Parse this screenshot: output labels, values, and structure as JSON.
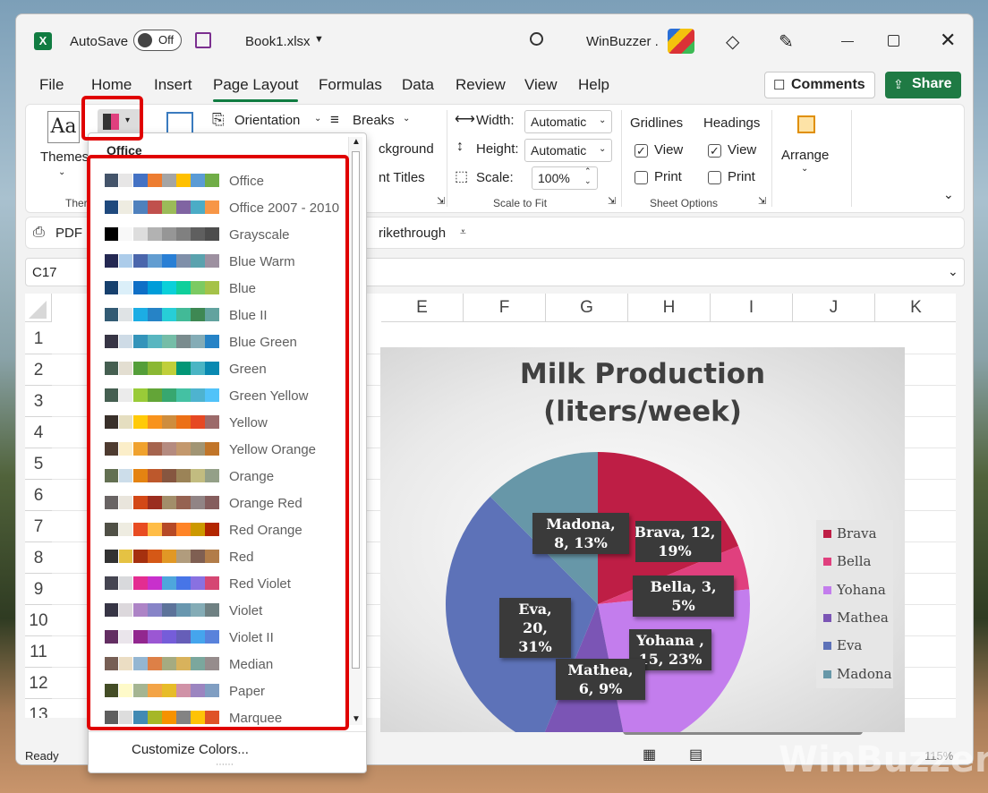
{
  "titlebar": {
    "autosave": "AutoSave",
    "toggle": "Off",
    "filename": "Book1.xlsx",
    "account": "WinBuzzer ."
  },
  "tabs": [
    "File",
    "Home",
    "Insert",
    "Page Layout",
    "Formulas",
    "Data",
    "Review",
    "View",
    "Help"
  ],
  "buttons": {
    "comments": "Comments",
    "share": "Share"
  },
  "ribbon": {
    "themes": "Themes",
    "themes_group": "Ther",
    "orientation": "Orientation",
    "breaks": "Breaks",
    "background": "ckground",
    "print_titles": "nt Titles",
    "width": "Width:",
    "height": "Height:",
    "scale": "Scale:",
    "width_val": "Automatic",
    "height_val": "Automatic",
    "scale_val": "100%",
    "scale_group": "Scale to Fit",
    "gridlines": "Gridlines",
    "headings": "Headings",
    "view": "View",
    "print": "Print",
    "sheet_options": "Sheet Options",
    "arrange": "Arrange"
  },
  "qat": {
    "pdf": "PDF",
    "strike": "rikethrough"
  },
  "namebox": "C17",
  "columns": [
    "E",
    "F",
    "G",
    "H",
    "I",
    "J",
    "K"
  ],
  "rows": [
    "1",
    "2",
    "3",
    "4",
    "5",
    "6",
    "7",
    "8",
    "9",
    "10",
    "11",
    "12",
    "13"
  ],
  "colors_menu": {
    "header": "Office",
    "footer": "Customize Colors...",
    "items": [
      {
        "name": "Office",
        "colors": [
          "#44546a",
          "#e7e6e6",
          "#4472c4",
          "#ed7d31",
          "#a5a5a5",
          "#ffc000",
          "#5b9bd5",
          "#70ad47"
        ]
      },
      {
        "name": "Office 2007 - 2010",
        "colors": [
          "#1f497d",
          "#eeece1",
          "#4f81bd",
          "#c0504d",
          "#9bbb59",
          "#8064a2",
          "#4bacc6",
          "#f79646"
        ]
      },
      {
        "name": "Grayscale",
        "colors": [
          "#000000",
          "#f8f8f8",
          "#dddddd",
          "#b2b2b2",
          "#969696",
          "#808080",
          "#5f5f5f",
          "#4d4d4d"
        ]
      },
      {
        "name": "Blue Warm",
        "colors": [
          "#242852",
          "#acccea",
          "#4a66ac",
          "#629dd1",
          "#297fd5",
          "#7f8fa9",
          "#5aa2ae",
          "#9d90a0"
        ]
      },
      {
        "name": "Blue",
        "colors": [
          "#17406d",
          "#dbeff9",
          "#0f6fc6",
          "#009dd9",
          "#0bd0d9",
          "#10cf9b",
          "#7cca62",
          "#a5c249"
        ]
      },
      {
        "name": "Blue II",
        "colors": [
          "#335b74",
          "#dfe3e5",
          "#1cade4",
          "#2683c6",
          "#27ced7",
          "#42ba97",
          "#3e8853",
          "#62a39f"
        ]
      },
      {
        "name": "Blue Green",
        "colors": [
          "#373545",
          "#cedbe6",
          "#3494ba",
          "#58b6c0",
          "#75bda7",
          "#7a8c8e",
          "#84acb6",
          "#2683c6"
        ]
      },
      {
        "name": "Green",
        "colors": [
          "#455f51",
          "#e3ded1",
          "#549e39",
          "#8ab833",
          "#c0cf3a",
          "#029676",
          "#4ab5c4",
          "#0989b1"
        ]
      },
      {
        "name": "Green Yellow",
        "colors": [
          "#455f51",
          "#ebebeb",
          "#99cb38",
          "#63a537",
          "#37a76f",
          "#44c1a3",
          "#4eb3cf",
          "#51c3f9"
        ]
      },
      {
        "name": "Yellow",
        "colors": [
          "#39302a",
          "#e5dec0",
          "#ffca08",
          "#f8931d",
          "#ce8d3e",
          "#ec7016",
          "#e64823",
          "#9c6a6a"
        ]
      },
      {
        "name": "Yellow Orange",
        "colors": [
          "#4e3b30",
          "#fbeec9",
          "#f0a22e",
          "#a5644e",
          "#b58b80",
          "#c3986d",
          "#a19574",
          "#c17529"
        ]
      },
      {
        "name": "Orange",
        "colors": [
          "#637052",
          "#ccddea",
          "#e48312",
          "#bd582c",
          "#865640",
          "#9b8357",
          "#c2bc80",
          "#94a088"
        ]
      },
      {
        "name": "Orange Red",
        "colors": [
          "#696464",
          "#e9e5dc",
          "#d34817",
          "#9b2d1f",
          "#a28e6a",
          "#956251",
          "#918485",
          "#855d5d"
        ]
      },
      {
        "name": "Red Orange",
        "colors": [
          "#505046",
          "#eeece1",
          "#e84c22",
          "#ffbd47",
          "#b64926",
          "#ff8427",
          "#cc9900",
          "#b22600"
        ]
      },
      {
        "name": "Red",
        "colors": [
          "#323232",
          "#e5c243",
          "#a5300f",
          "#d55816",
          "#e19825",
          "#b19c7d",
          "#7f5f52",
          "#b27d49"
        ]
      },
      {
        "name": "Red Violet",
        "colors": [
          "#454551",
          "#d8d9dc",
          "#e32d91",
          "#c830cc",
          "#4ea6dc",
          "#4775e7",
          "#8971e1",
          "#d54773"
        ]
      },
      {
        "name": "Violet",
        "colors": [
          "#373545",
          "#dcd8dc",
          "#ad84c6",
          "#8784c7",
          "#5d739a",
          "#6997af",
          "#84acb6",
          "#6f8183"
        ]
      },
      {
        "name": "Violet II",
        "colors": [
          "#632e62",
          "#eae5eb",
          "#92278f",
          "#9b57d3",
          "#755dd9",
          "#665eb8",
          "#45a5ed",
          "#5982db"
        ]
      },
      {
        "name": "Median",
        "colors": [
          "#775f55",
          "#ebddc3",
          "#94b6d2",
          "#dd8047",
          "#a5ab81",
          "#d8b25c",
          "#7ba79d",
          "#968c8c"
        ]
      },
      {
        "name": "Paper",
        "colors": [
          "#444d26",
          "#fefac9",
          "#a5b592",
          "#f3a447",
          "#e7bc29",
          "#d092a7",
          "#9c85c0",
          "#809ec2"
        ]
      },
      {
        "name": "Marquee",
        "colors": [
          "#5e5e5e",
          "#dddddd",
          "#418ab3",
          "#a6b727",
          "#f69200",
          "#838383",
          "#fec306",
          "#df5327"
        ]
      }
    ]
  },
  "chart_data": {
    "type": "pie",
    "title": "Milk Production (liters/week)",
    "categories": [
      "Brava",
      "Bella",
      "Yohana",
      "Mathea",
      "Eva",
      "Madona"
    ],
    "values": [
      12,
      3,
      15,
      6,
      20,
      8
    ],
    "data_labels": [
      "Brava, 12, 19%",
      "Bella, 3, 5%",
      "Yohana , 15, 23%",
      "Mathea, 6, 9%",
      "Eva, 20, 31%",
      "Madona, 8, 13%"
    ],
    "colors": [
      "#be1e45",
      "#e0407e",
      "#c37ded",
      "#7b55b5",
      "#5d72b8",
      "#6797a8"
    ],
    "legend_position": "right"
  },
  "status": {
    "ready": "Ready",
    "zoom": "115%"
  }
}
